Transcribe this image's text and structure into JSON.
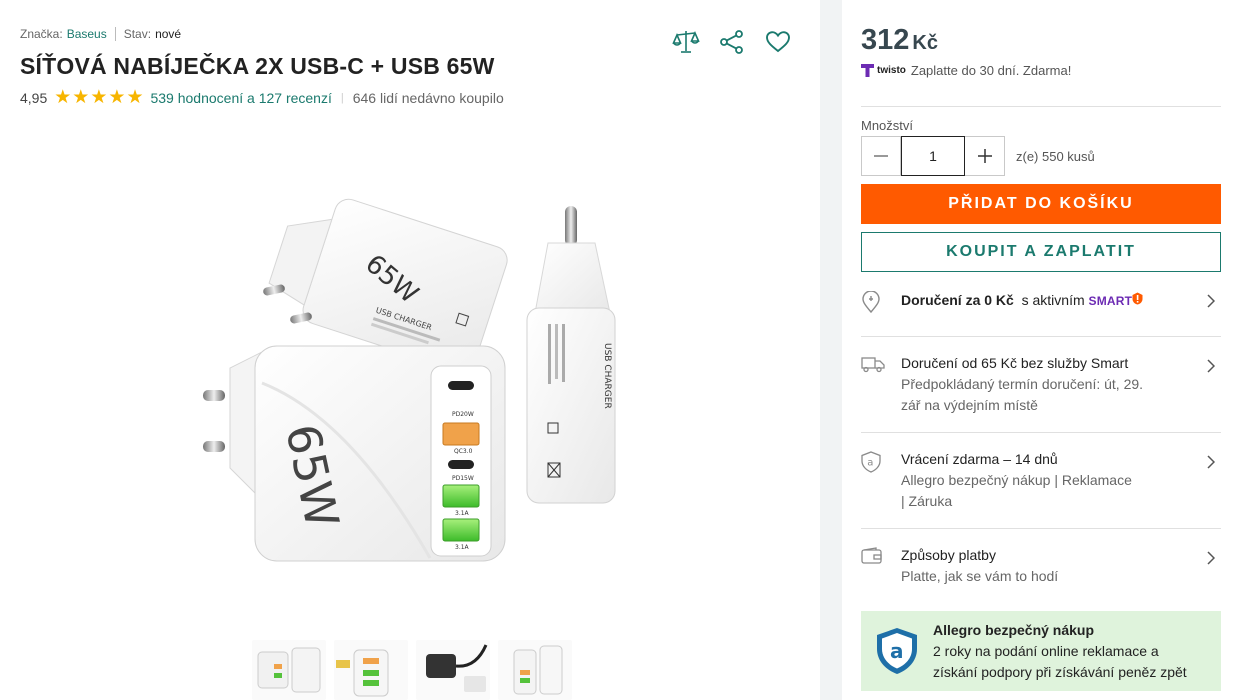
{
  "meta": {
    "brand_label": "Značka:",
    "brand_value": "Baseus",
    "condition_label": "Stav:",
    "condition_value": "nové"
  },
  "product": {
    "title": "SÍŤOVÁ NABÍJEČKA 2X USB-C + USB 65W",
    "rating_value": "4,95",
    "rating_stars": 5,
    "reviews_link": "539 hodnocení a 127 recenzí",
    "recent_buyers": "646 lidí nedávno koupilo"
  },
  "image_text": {
    "charger_big": "65W",
    "port_pd20": "PD20W",
    "port_qc": "QC3.0",
    "port_pd15": "PD15W",
    "port_31a": "3.1A",
    "port_31b": "3.1A",
    "usb_charger": "USB CHARGER",
    "charger_top": "65W"
  },
  "top_icons": [
    "compare-icon",
    "share-icon",
    "heart-icon"
  ],
  "buy": {
    "price": "312",
    "currency": "Kč",
    "twisto_brand": "twisto",
    "twisto_text": "Zaplatte do 30 dní. Zdarma!",
    "qty_label": "Množství",
    "qty_value": "1",
    "qty_available": "z(e) 550 kusů",
    "add_to_cart": "PŘIDAT DO KOŠÍKU",
    "buy_now": "KOUPIT A ZAPLATIT"
  },
  "delivery_smart": {
    "bold": "Doručení za 0 Kč",
    "rest": "s aktivním",
    "smart": "SMART"
  },
  "delivery": {
    "line1": "Doručení od 65 Kč bez služby Smart",
    "line2": "Předpokládaný termín doručení: út, 29.",
    "line3": "zář na výdejním místě"
  },
  "returns": {
    "line1": "Vrácení zdarma – 14 dnů",
    "line2": "Allegro bezpečný nákup | Reklamace",
    "line3": "| Záruka"
  },
  "payment": {
    "line1": "Způsoby platby",
    "line2": "Platte, jak se vám to hodí"
  },
  "safe": {
    "title": "Allegro bezpečný nákup",
    "line1": "2 roky na podání online reklamace a",
    "line2": "získání podpory při získávání peněz zpět"
  },
  "colors": {
    "accent_teal": "#1b7a6e",
    "orange": "#ff5a00",
    "star": "#f7b500",
    "safe_bg": "#dff3dc"
  }
}
